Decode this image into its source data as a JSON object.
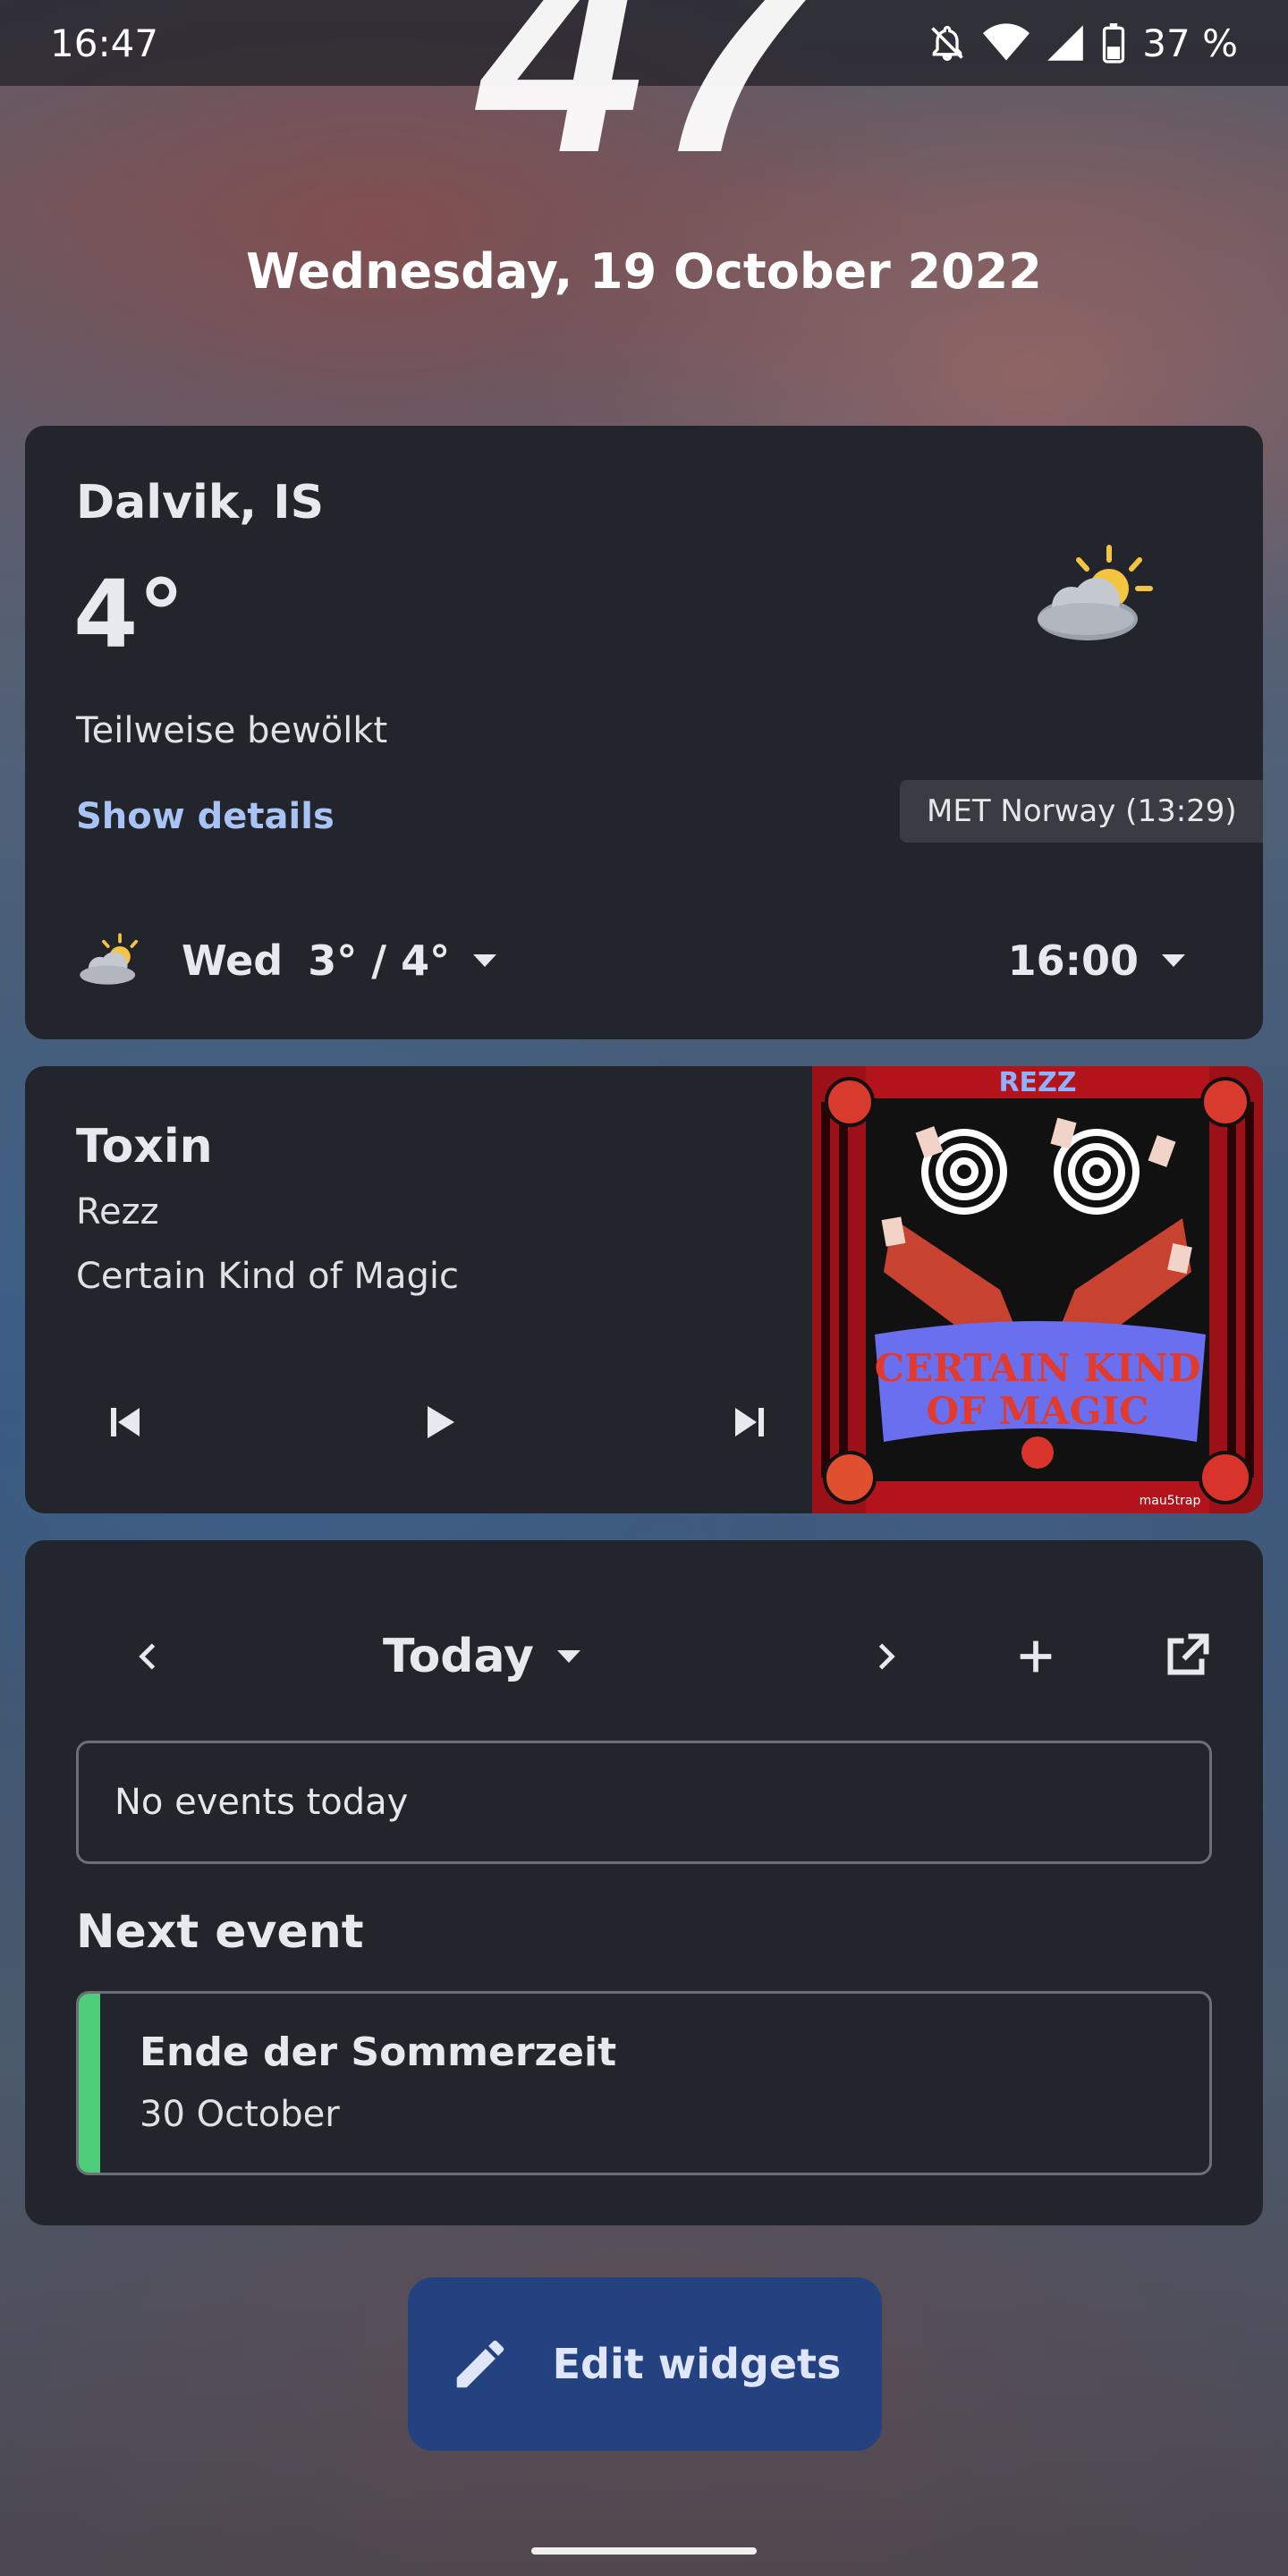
{
  "status": {
    "time": "16:47",
    "battery": "37 %",
    "icons": [
      "bell-off-icon",
      "wifi-icon",
      "signal-icon",
      "battery-icon"
    ]
  },
  "lockscreen": {
    "clock_minutes": "47",
    "date": "Wednesday, 19 October 2022"
  },
  "weather": {
    "location": "Dalvik, IS",
    "temperature": "4°",
    "condition": "Teilweise bewölkt",
    "details_link": "Show details",
    "source": "MET Norway (13:29)",
    "forecast_day": "Wed",
    "forecast_range": "3° / 4°",
    "forecast_time": "16:00",
    "icon": "partly-cloudy-icon"
  },
  "media": {
    "title": "Toxin",
    "artist": "Rezz",
    "album": "Certain Kind of Magic",
    "art_text_line1": "CERTAIN KIND",
    "art_text_line2": "OF MAGIC",
    "art_brand": "REZZ",
    "art_label": "mau5trap"
  },
  "calendar": {
    "range_label": "Today",
    "no_events": "No events today",
    "next_event_label": "Next event",
    "next_event": {
      "title": "Ende der Sommerzeit",
      "date": "30 October",
      "color": "#4fce7a"
    }
  },
  "edit": {
    "label": "Edit widgets"
  },
  "colors": {
    "card": "#23252d",
    "accent_link": "#a9c3f6",
    "edit_button": "#24427f"
  }
}
